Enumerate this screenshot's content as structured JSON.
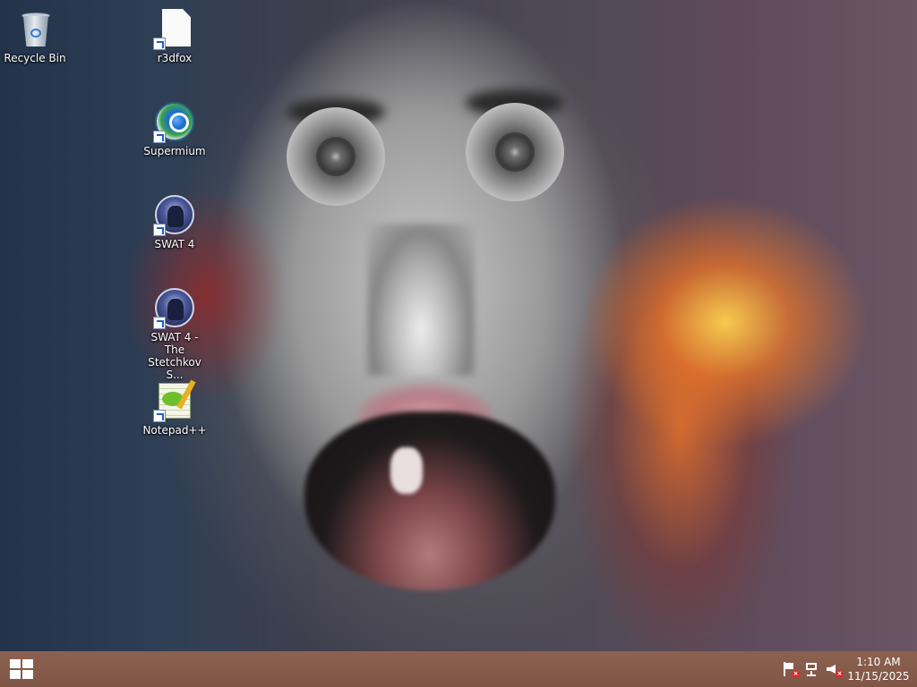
{
  "desktop": {
    "icons": [
      {
        "label": "Recycle Bin",
        "icon": "recycle-bin-icon"
      },
      {
        "label": "r3dfox",
        "icon": "file-icon"
      },
      {
        "label": "Supermium",
        "icon": "supermium-icon"
      },
      {
        "label": "SWAT 4",
        "icon": "swat4-icon"
      },
      {
        "label": "SWAT 4 - The Stetchkov S...",
        "icon": "swat4-icon"
      },
      {
        "label": "Notepad++",
        "icon": "notepad-plus-plus-icon"
      }
    ]
  },
  "taskbar": {
    "start_icon": "windows-logo-icon",
    "tray": {
      "icons": [
        "action-center-flag-icon",
        "network-icon",
        "volume-muted-icon"
      ],
      "clock": {
        "time": "1:10 AM",
        "date": "11/15/2025"
      }
    }
  },
  "colors": {
    "taskbar": "#8a5e4c",
    "icon_text": "#ffffff",
    "tray_error": "#d62a2a"
  }
}
